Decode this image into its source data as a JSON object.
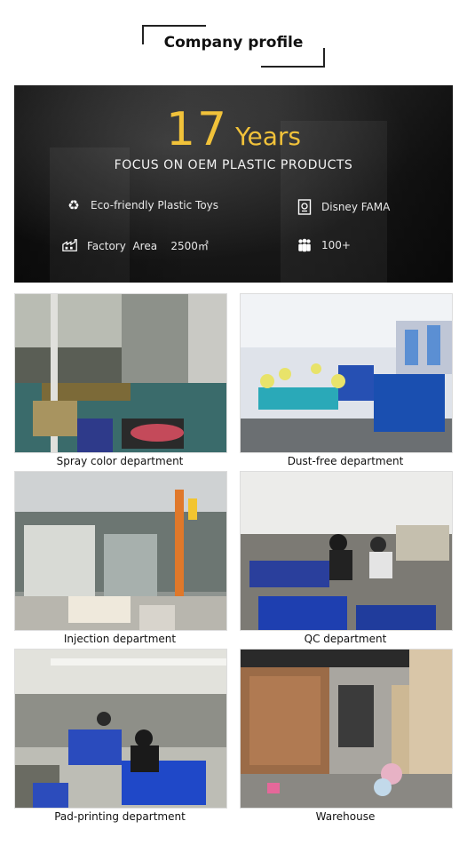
{
  "header": {
    "title": "Company profile"
  },
  "banner": {
    "years_number": "17",
    "years_word": "Years",
    "tagline": "FOCUS ON OEM PLASTIC PRODUCTS",
    "features": [
      {
        "icon": "recycle-icon",
        "label": "Eco-friendly Plastic Toys"
      },
      {
        "icon": "certificate-icon",
        "label": "Disney FAMA"
      },
      {
        "icon": "factory-icon",
        "label": "Factory  Area    2500㎡"
      },
      {
        "icon": "people-icon",
        "label": "100+"
      }
    ]
  },
  "departments": [
    {
      "caption": "Spray color department"
    },
    {
      "caption": "Dust-free department"
    },
    {
      "caption": "Injection department"
    },
    {
      "caption": "QC department"
    },
    {
      "caption": "Pad-printing department"
    },
    {
      "caption": "Warehouse"
    }
  ],
  "colors": {
    "gold": "#f1c23a",
    "banner_bg": "#1d1d1d"
  }
}
